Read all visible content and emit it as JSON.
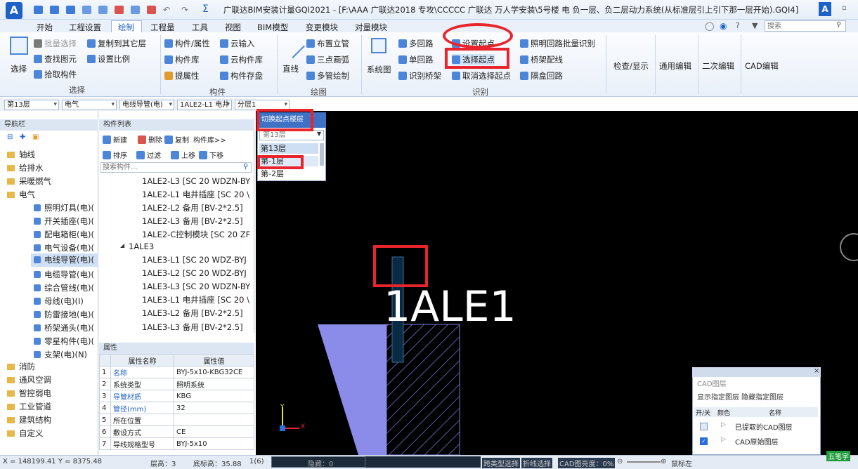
{
  "app": {
    "title": "广联达BIM安装计量GQI2021 - [F:\\AAA 广联达2018 专攻\\CCCCC   广联达  万人学安装\\5号楼 电 负一层、负二层动力系统(从标准层引上引下那一层开始).GQI4]",
    "logo": "A"
  },
  "menu": {
    "tabs": [
      "开始",
      "工程设置",
      "绘制",
      "工程量",
      "工具",
      "视图",
      "BIM模型",
      "变更模块",
      "对量模块"
    ],
    "active": "绘制",
    "search_placeholder": "搜索",
    "help": "?"
  },
  "ribbon": {
    "select": {
      "big": "选择",
      "items": [
        "批量选择",
        "查找图元",
        "拾取构件",
        "复制到其它层",
        "设置比例"
      ],
      "group": "选择"
    },
    "component": {
      "items": [
        "构件/属性",
        "构件库",
        "提属性",
        "云输入",
        "云构件库",
        "构件存盘"
      ],
      "group": "构件"
    },
    "draw": {
      "big": "直线",
      "items": [
        "布置立管",
        "三点画弧",
        "多管绘制"
      ],
      "group": "绘图"
    },
    "identify": {
      "big": "系统图",
      "items": [
        "多回路",
        "单回路",
        "识别桥架",
        "设置起点",
        "选择起点",
        "取消选择起点",
        "照明回路批量识别",
        "桥架配线",
        "隔盒回路"
      ],
      "group": "识别"
    },
    "more": [
      "检查/显示",
      "通用编辑",
      "二次编辑",
      "CAD编辑"
    ]
  },
  "selectors": [
    "第13层",
    "电气",
    "电线导管(电)",
    "1ALE2-L1 电井",
    "分层1"
  ],
  "nav": {
    "title": "导航栏",
    "folders": [
      "轴线",
      "给排水",
      "采暖燃气",
      "电气"
    ],
    "electric_items": [
      "照明灯具(电)(",
      "开关插座(电)(",
      "配电箱柜(电)(",
      "电气设备(电)(",
      "电线导管(电)(",
      "电缆导管(电)(",
      "综合管线(电)(",
      "母线(电)(I)",
      "防雷接地(电)(",
      "桥架通头(电)(",
      "零星构件(电)(",
      "支架(电)(N)"
    ],
    "folders_after": [
      "消防",
      "通风空调",
      "智控弱电",
      "工业管道",
      "建筑结构",
      "自定义"
    ]
  },
  "component_list": {
    "title": "构件列表",
    "toolbar": [
      "新建",
      "删除",
      "复制",
      "构件库>>"
    ],
    "toolbar2": [
      "排序",
      "过滤",
      "上移",
      "下移"
    ],
    "search_placeholder": "搜索构件...",
    "items": [
      "1ALE2-L3 [SC 20 WDZN-BY",
      "1ALE2-L1 电井插座 [SC 20 \\",
      "1ALE2-L2 备用 [BV-2*2.5]",
      "1ALE2-L3 备用 [BV-2*2.5]",
      "1ALE2-C控制模块 [SC 20 ZF",
      "1ALE3",
      "1ALE3-L1 [SC 20 WDZ-BYJ",
      "1ALE3-L2 [SC 20 WDZ-BYJ",
      "1ALE3-L3 [SC 20 WDZN-BY",
      "1ALE3-L1 电井插座 [SC 20 \\",
      "1ALE3-L2 备用 [BV-2*2.5]",
      "1ALE3-L3 备用 [BV-2*2.5]"
    ]
  },
  "props": {
    "title": "属性",
    "headers": [
      "属性名称",
      "属性值"
    ],
    "rows": [
      [
        "1",
        "名称",
        "BYJ-5x10-KBG32CE"
      ],
      [
        "2",
        "系统类型",
        "照明系统"
      ],
      [
        "3",
        "导管材质",
        "KBG"
      ],
      [
        "4",
        "管径(mm)",
        "32"
      ],
      [
        "5",
        "所在位置",
        ""
      ],
      [
        "6",
        "敷设方式",
        "CE"
      ],
      [
        "7",
        "导线规格型号",
        "BYJ-5x10"
      ]
    ]
  },
  "floor_popup": {
    "title": "切换起点楼层",
    "current": "第13层",
    "options": [
      "第13层",
      "第-1层",
      "第-2层"
    ]
  },
  "canvas": {
    "label": "1ALE1",
    "axis_x": "X",
    "axis_y": "Y"
  },
  "cad_panel": {
    "title": "CAD图层",
    "tabs": [
      "显示指定图层",
      "隐藏指定图层"
    ],
    "headers": [
      "开/关",
      "颜色",
      "名称"
    ],
    "rows": [
      "已提取的CAD图层",
      "CAD原始图层"
    ]
  },
  "status": {
    "coords": "X = 148199.41 Y = 8375.48",
    "floor_height": "层高：3",
    "bottom_elev": "底标高：35.88",
    "count": "1(6)",
    "hidden": "隐藏：0",
    "type_select": "跨类型选择",
    "fold_select": "折线选择",
    "cad_brightness": "CAD图亮度：0%",
    "mouse": "鼠标左",
    "ime": "五笔字"
  }
}
